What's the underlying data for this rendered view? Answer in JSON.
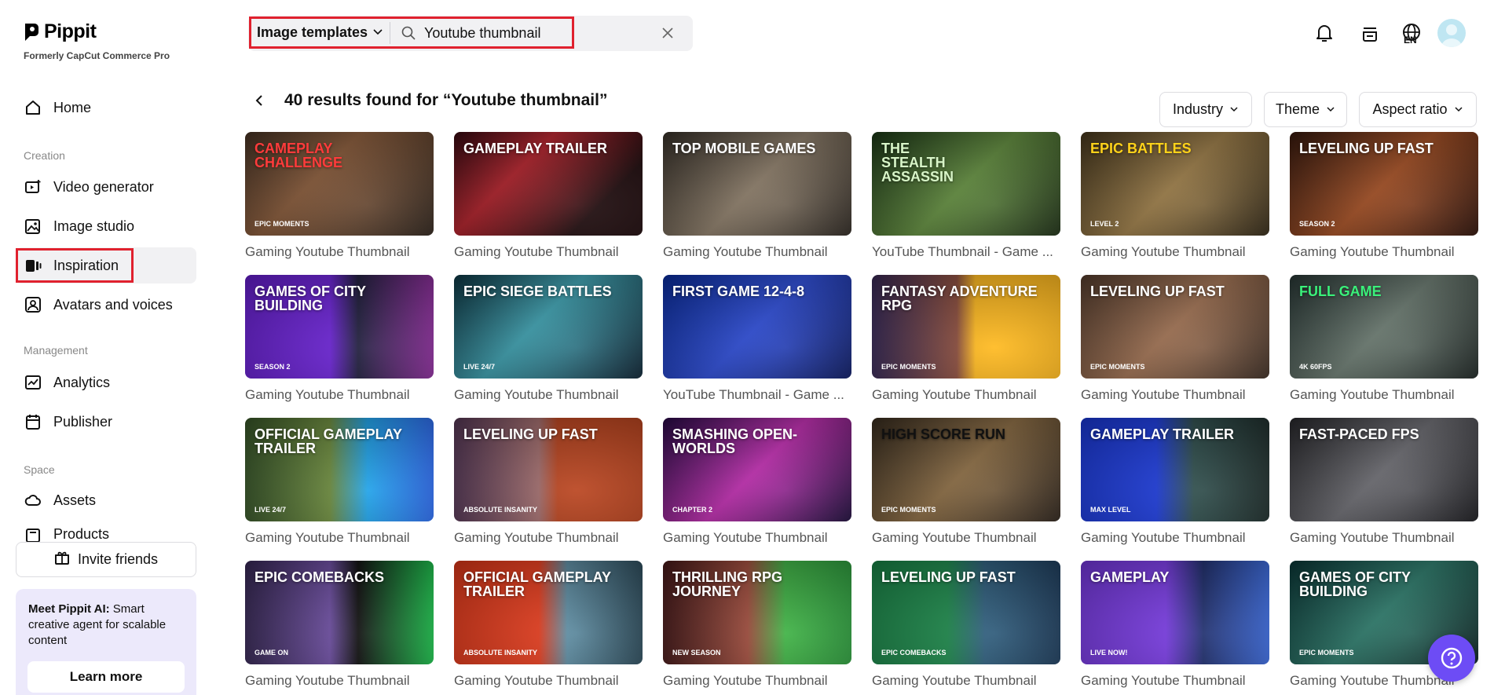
{
  "brand": {
    "name": "Pippit",
    "subtitle": "Formerly CapCut Commerce Pro"
  },
  "sidebar": {
    "home": "Home",
    "sections": {
      "creation": "Creation",
      "management": "Management",
      "space": "Space"
    },
    "creation_items": [
      {
        "label": "Video generator",
        "icon": "video-plus-icon"
      },
      {
        "label": "Image studio",
        "icon": "image-sparkle-icon"
      },
      {
        "label": "Inspiration",
        "icon": "inspiration-icon",
        "active": true
      },
      {
        "label": "Avatars and voices",
        "icon": "avatar-icon"
      }
    ],
    "management_items": [
      {
        "label": "Analytics",
        "icon": "chart-icon"
      },
      {
        "label": "Publisher",
        "icon": "calendar-icon"
      }
    ],
    "space_items": [
      {
        "label": "Assets",
        "icon": "cloud-icon"
      },
      {
        "label": "Products",
        "icon": "box-icon"
      }
    ],
    "invite_label": "Invite friends",
    "promo": {
      "title": "Meet Pippit AI:",
      "text": " Smart creative agent for scalable content",
      "button": "Learn more"
    }
  },
  "search": {
    "category": "Image templates",
    "query": "Youtube thumbnail"
  },
  "topbar": {
    "lang": "EN"
  },
  "results": {
    "title": "40 results found for “Youtube thumbnail”",
    "filters": [
      "Industry",
      "Theme",
      "Aspect ratio"
    ]
  },
  "templates": [
    {
      "caption": "Gaming Youtube Thumbnail",
      "title": "CAMEPLAY CHALLENGE",
      "tag": "EPIC MOMENTS",
      "bg": "linear-gradient(135deg,#4a3526,#8a5a38 40%,#2b2018)",
      "tc": "#ff3b3b"
    },
    {
      "caption": "Gaming Youtube Thumbnail",
      "title": "GAMEPLAY TRAILER",
      "tag": "",
      "bg": "linear-gradient(135deg,#3a0a12,#b8202a 35%,#1a0608 75%)",
      "tc": "#ffffff"
    },
    {
      "caption": "Gaming Youtube Thumbnail",
      "title": "TOP MOBILE GAMES",
      "tag": "",
      "bg": "linear-gradient(135deg,#3b342c,#8a7a66 50%,#2a241e)",
      "tc": "#ffffff"
    },
    {
      "caption": "YouTube Thumbnail - Game ...",
      "title": "THE STEALTH ASSASSIN",
      "tag": "",
      "bg": "linear-gradient(135deg,#1d3a18,#5e8a3a 50%,#1a2c12)",
      "tc": "#d8f5c8"
    },
    {
      "caption": "Gaming Youtube Thumbnail",
      "title": "EPIC BATTLES",
      "tag": "LEVEL 2",
      "bg": "linear-gradient(135deg,#4a3a1e,#9a7a44 50%,#2e2412)",
      "tc": "#ffd21a"
    },
    {
      "caption": "Gaming Youtube Thumbnail",
      "title": "LEVELING UP FAST",
      "tag": "SEASON 2",
      "bg": "linear-gradient(135deg,#3a1a0e,#a04a1e 50%,#2a0e06)",
      "tc": "#ffffff"
    },
    {
      "caption": "Gaming Youtube Thumbnail",
      "title": "GAMES OF CITY BUILDING",
      "tag": "SEASON 2",
      "bg": "linear-gradient(90deg,#6a1fd8 45%,#1a1838 60%,#8a2a9a)",
      "tc": "#ffffff"
    },
    {
      "caption": "Gaming Youtube Thumbnail",
      "title": "EPIC SIEGE BATTLES",
      "tag": "LIVE 24/7",
      "bg": "linear-gradient(135deg,#0e3a48,#3aa0b0 45%,#0a2030)",
      "tc": "#ffffff"
    },
    {
      "caption": "YouTube Thumbnail - Game ...",
      "title": "FIRST GAME 12-4-8",
      "tag": "",
      "bg": "linear-gradient(135deg,#0a2fa8,#2a4ad8 50%,#0a1860)",
      "tc": "#ffffff"
    },
    {
      "caption": "Gaming Youtube Thumbnail",
      "title": "FANTASY ADVENTURE RPG",
      "tag": "EPIC MOMENTS",
      "bg": "linear-gradient(90deg,#3a2a5a,#8a4a3a 45%,#ffb81a 55%)",
      "tc": "#ffffff"
    },
    {
      "caption": "Gaming Youtube Thumbnail",
      "title": "LEVELING UP FAST",
      "tag": "EPIC MOMENTS",
      "bg": "linear-gradient(135deg,#5a4030,#a07050 50%,#3a2a20)",
      "tc": "#ffffff"
    },
    {
      "caption": "Gaming Youtube Thumbnail",
      "title": "FULL GAME",
      "tag": "4K 60FPS",
      "bg": "linear-gradient(135deg,#2a3a38,#6a7a70 50%,#1a2220)",
      "tc": "#3af07a"
    },
    {
      "caption": "Gaming Youtube Thumbnail",
      "title": "OFFICIAL GAMEPLAY TRAILER",
      "tag": "LIVE 24/7",
      "bg": "linear-gradient(90deg,#3a5a2a,#6a8a3a 45%,#1aa0e8 65%,#2a6af0)",
      "tc": "#ffffff"
    },
    {
      "caption": "Gaming Youtube Thumbnail",
      "title": "LEVELING UP FAST",
      "tag": "ABSOLUTE INSANITY",
      "bg": "linear-gradient(90deg,#5a3a5a,#a06a6a 45%,#b8401a 55%)",
      "tc": "#ffffff"
    },
    {
      "caption": "Gaming Youtube Thumbnail",
      "title": "SMASHING OPEN-WORLDS",
      "tag": "CHAPTER 2",
      "bg": "linear-gradient(135deg,#2a0a4a,#c02ab0 50%,#1a0a38)",
      "tc": "#ffffff"
    },
    {
      "caption": "Gaming Youtube Thumbnail",
      "title": "HIGH SCORE RUN",
      "tag": "EPIC MOMENTS",
      "bg": "linear-gradient(135deg,#3a2e20,#8a6a40 50%,#2a2018)",
      "tc": "#111111"
    },
    {
      "caption": "Gaming Youtube Thumbnail",
      "title": "GAMEPLAY TRAILER",
      "tag": "MAX LEVEL",
      "bg": "linear-gradient(90deg,#1a3ae0 40%,#2a4a48 60%,#1a2a28)",
      "tc": "#ffffff"
    },
    {
      "caption": "Gaming Youtube Thumbnail",
      "title": "FAST-PACED FPS",
      "tag": "",
      "bg": "linear-gradient(135deg,#2a2a2e,#6a6a70 50%,#18181c)",
      "tc": "#ffffff"
    },
    {
      "caption": "Gaming Youtube Thumbnail",
      "title": "EPIC COMEBACKS",
      "tag": "GAME ON",
      "bg": "linear-gradient(90deg,#3a2a5a,#6a4aa0 45%,#0a0a0a 60%,#1ac04a)",
      "tc": "#ffffff"
    },
    {
      "caption": "Gaming Youtube Thumbnail",
      "title": "OFFICIAL GAMEPLAY TRAILER",
      "tag": "ABSOLUTE INSANITY",
      "bg": "linear-gradient(90deg,#e83a1a 45%,#5a8aa0 60%,#2a4a5a)",
      "tc": "#ffffff"
    },
    {
      "caption": "Gaming Youtube Thumbnail",
      "title": "THRILLING RPG JOURNEY",
      "tag": "NEW SEASON",
      "bg": "linear-gradient(90deg,#4a1a1a,#a04a3a 45%,#3ab040 65%,#2a9a3a)",
      "tc": "#ffffff"
    },
    {
      "caption": "Gaming Youtube Thumbnail",
      "title": "LEVELING UP FAST",
      "tag": "EPIC COMEBACKS",
      "bg": "linear-gradient(90deg,#1a8a4a 40%,#2a5a7a 60%,#1a3a5a)",
      "tc": "#ffffff"
    },
    {
      "caption": "Gaming Youtube Thumbnail",
      "title": "GAMEPLAY",
      "tag": "LIVE NOW!",
      "bg": "linear-gradient(90deg,#7a3ae8 45%,#1a2a6a 65%,#3a6ae0)",
      "tc": "#ffffff"
    },
    {
      "caption": "Gaming Youtube Thumbnail",
      "title": "GAMES OF CITY BUILDING",
      "tag": "EPIC MOMENTS",
      "bg": "linear-gradient(135deg,#0a3a3a,#2a7a6a 50%,#0a2020)",
      "tc": "#ffffff"
    }
  ]
}
